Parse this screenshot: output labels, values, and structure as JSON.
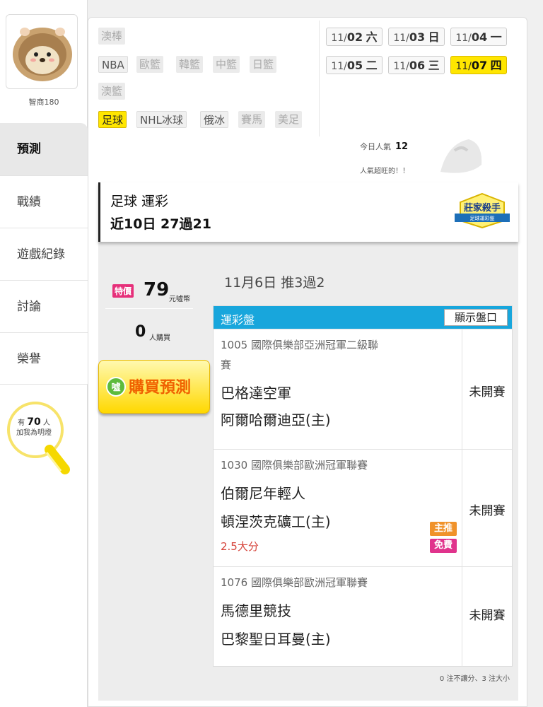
{
  "user": {
    "name": "智商180"
  },
  "nav": [
    {
      "label": "預測"
    },
    {
      "label": "戰績"
    },
    {
      "label": "遊戲紀錄"
    },
    {
      "label": "討論"
    },
    {
      "label": "榮譽"
    }
  ],
  "fans": {
    "prefix": "有",
    "count": "70",
    "suffix": "人",
    "line2": "加我為明燈"
  },
  "sports": [
    {
      "label": "澳棒"
    },
    {
      "label": "NBA"
    },
    {
      "label": "歐籃"
    },
    {
      "label": "韓籃"
    },
    {
      "label": "中籃"
    },
    {
      "label": "日籃"
    },
    {
      "label": "澳籃"
    },
    {
      "label": "足球"
    },
    {
      "label": "NHL冰球"
    },
    {
      "label": "俄冰"
    },
    {
      "label": "賽馬"
    },
    {
      "label": "美足"
    }
  ],
  "dates": [
    {
      "month": "11/",
      "day": "02",
      "weekday": "六"
    },
    {
      "month": "11/",
      "day": "03",
      "weekday": "日"
    },
    {
      "month": "11/",
      "day": "04",
      "weekday": "一"
    },
    {
      "month": "11/",
      "day": "05",
      "weekday": "二"
    },
    {
      "month": "11/",
      "day": "06",
      "weekday": "三"
    },
    {
      "month": "11/",
      "day": "07",
      "weekday": "四"
    }
  ],
  "popularity": {
    "label": "今日人氣",
    "value": "12",
    "note": "人氣超旺的！！"
  },
  "banner": {
    "title": "足球 運彩",
    "record": "近10日 27過21",
    "badge_line1": "莊家殺手",
    "badge_line2": "足球運彩盤"
  },
  "price": {
    "tag": "特價",
    "value": "79",
    "unit": "元噓幣"
  },
  "buyers": {
    "count": "0",
    "unit": "人購買"
  },
  "buy_button": {
    "icon_text": "噓",
    "label": "購買預測"
  },
  "prediction": {
    "date_title": "11月6日 推3過2",
    "table_label": "運彩盤",
    "show_odds_label": "顯示盤口",
    "rows": [
      {
        "league_line1": "1005 國際俱樂部亞洲冠軍二級聯",
        "league_line2": "賽",
        "team_away": "巴格達空軍",
        "team_home": "阿爾哈爾迪亞(主)",
        "status": "未開賽"
      },
      {
        "league_line1": "1030 國際俱樂部歐洲冠軍聯賽",
        "team_away": "伯爾尼年輕人",
        "team_home": "頓涅茨克礦工(主)",
        "spread": "2.5大分",
        "badge_main": "主推",
        "badge_free": "免費",
        "status": "未開賽"
      },
      {
        "league_line1": "1076 國際俱樂部歐洲冠軍聯賽",
        "team_away": "馬德里競技",
        "team_home": "巴黎聖日耳曼(主)",
        "status": "未開賽"
      }
    ],
    "footnote": "0 注不讓分、3 注大小"
  },
  "colors": {
    "accent_yellow": "#ffe600",
    "table_head": "#18a6dc",
    "price_tag": "#e6307a",
    "buy_text": "#f06000",
    "badge_main": "#f0922a",
    "badge_free": "#e0338c"
  }
}
